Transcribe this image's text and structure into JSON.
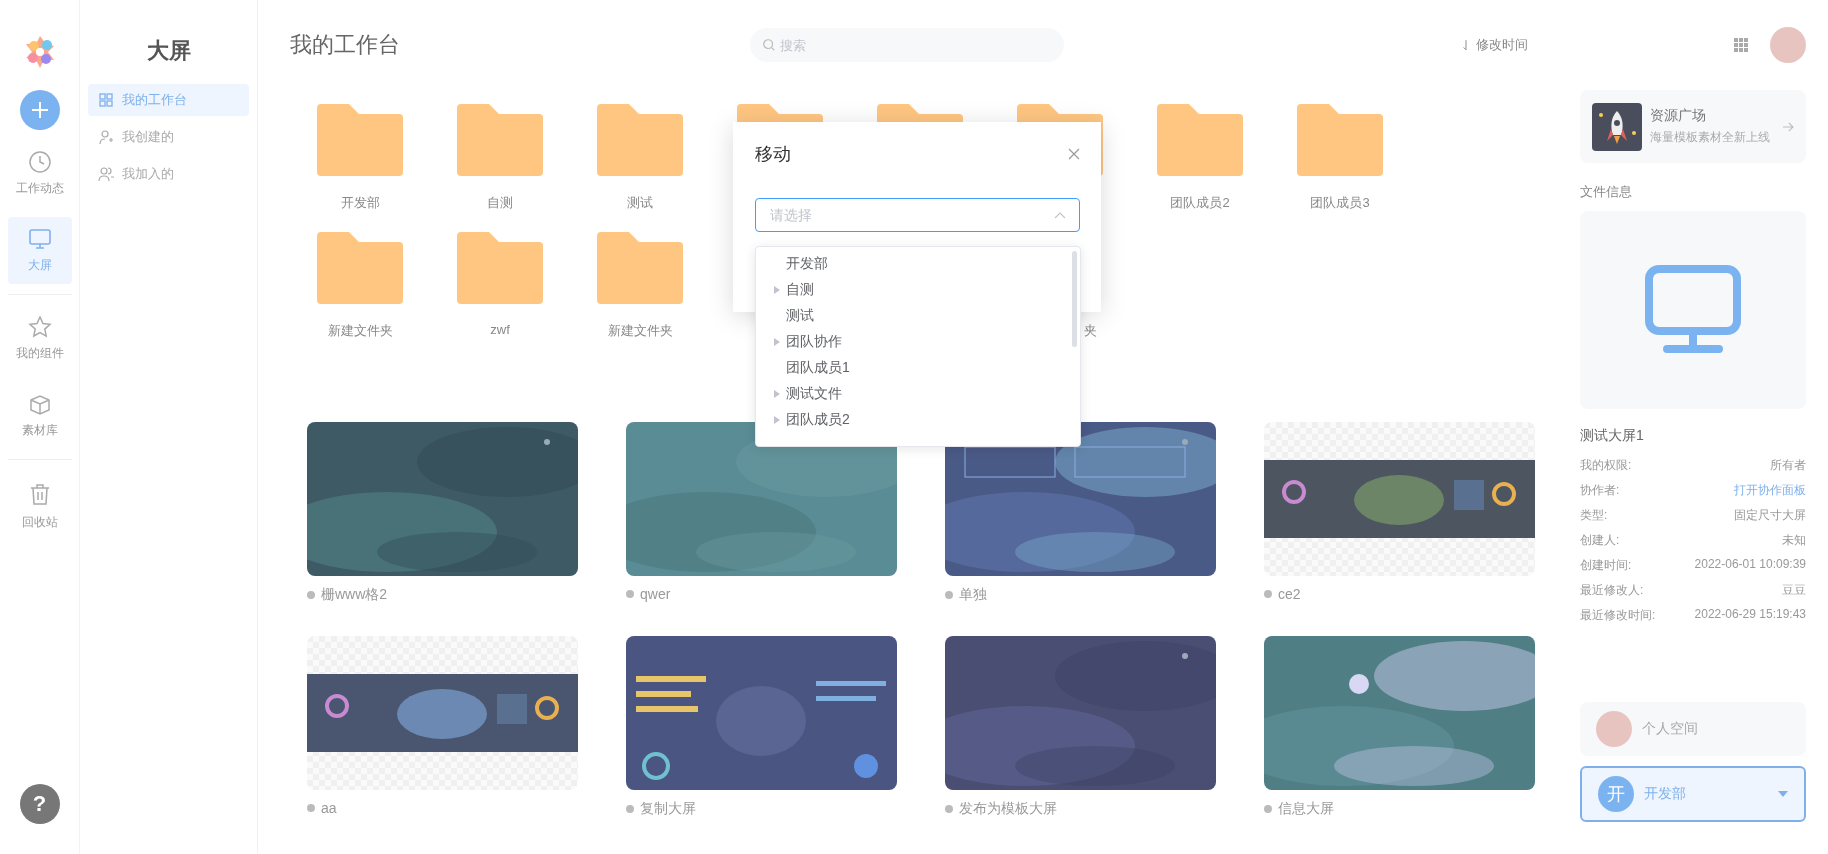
{
  "rail": {
    "help": "?",
    "items": [
      {
        "label": "工作动态",
        "selected": false
      },
      {
        "label": "大屏",
        "selected": true
      },
      {
        "label": "我的组件",
        "selected": false
      },
      {
        "label": "素材库",
        "selected": false
      },
      {
        "label": "回收站",
        "selected": false
      }
    ]
  },
  "sidebar": {
    "title": "大屏",
    "items": [
      {
        "label": "我的工作台",
        "selected": true
      },
      {
        "label": "我创建的",
        "selected": false
      },
      {
        "label": "我加入的",
        "selected": false
      }
    ]
  },
  "header": {
    "title": "我的工作台",
    "search": {
      "placeholder": "搜索"
    },
    "sort": {
      "label": "修改时间"
    }
  },
  "folders": [
    {
      "kind": "folder",
      "label": "开发部"
    },
    {
      "kind": "folder",
      "label": "自测"
    },
    {
      "kind": "folder",
      "label": "测试"
    },
    {
      "kind": "folder"
    },
    {
      "kind": "folder"
    },
    {
      "kind": "folder"
    },
    {
      "kind": "folder",
      "label": "团队成员2"
    },
    {
      "kind": "folder",
      "label": "团队成员3"
    },
    {
      "kind": "folder",
      "label": "新建文件夹"
    },
    {
      "kind": "folder",
      "label": "zwf"
    },
    {
      "kind": "folder",
      "label": "新建文件夹"
    },
    {
      "kind": "gap"
    },
    {
      "kind": "gap"
    },
    {
      "kind": "label",
      "label": "夹"
    }
  ],
  "screens": [
    {
      "name": "栅www格2"
    },
    {
      "name": "qwer"
    },
    {
      "name": "单独"
    },
    {
      "name": "ce2"
    },
    {
      "name": "aa"
    },
    {
      "name": "复制大屏"
    },
    {
      "name": "发布为模板大屏"
    },
    {
      "name": "信息大屏"
    }
  ],
  "panel": {
    "resource": {
      "title": "资源广场",
      "subtitle": "海量模板素材全新上线"
    },
    "info_title": "文件信息",
    "file_name": "测试大屏1",
    "props": [
      {
        "label": "我的权限:",
        "value": "所有者",
        "kind": "text"
      },
      {
        "label": "协作者:",
        "value": "打开协作面板",
        "kind": "link"
      },
      {
        "label": "类型:",
        "value": "固定尺寸大屏",
        "kind": "text"
      },
      {
        "label": "创建人:",
        "value": "未知",
        "kind": "text"
      },
      {
        "label": "创建时间:",
        "value": "2022-06-01 10:09:39",
        "kind": "text"
      },
      {
        "label": "最近修改人:",
        "value": "豆豆",
        "kind": "text"
      },
      {
        "label": "最近修改时间:",
        "value": "2022-06-29 15:19:43",
        "kind": "text"
      }
    ],
    "personal": {
      "label": "个人空间"
    },
    "team": {
      "initial": "开",
      "name": "开发部"
    }
  },
  "dialog": {
    "title": "移动",
    "select": {
      "placeholder": "请选择",
      "open": true
    },
    "options": [
      {
        "label": "开发部",
        "expandable": false
      },
      {
        "label": "自测",
        "expandable": true
      },
      {
        "label": "测试",
        "expandable": false
      },
      {
        "label": "团队协作",
        "expandable": true
      },
      {
        "label": "团队成员1",
        "expandable": false
      },
      {
        "label": "测试文件",
        "expandable": true
      },
      {
        "label": "团队成员2",
        "expandable": true
      }
    ]
  }
}
